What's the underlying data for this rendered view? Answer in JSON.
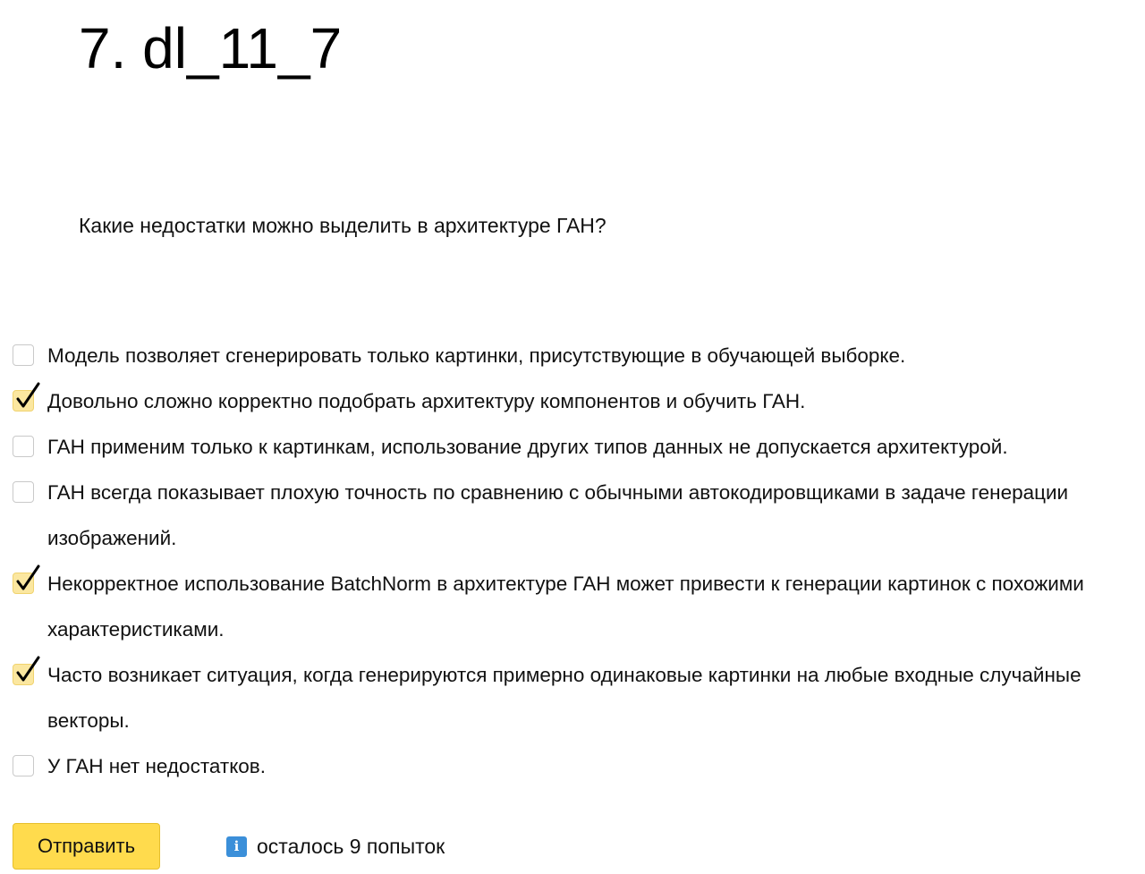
{
  "task": {
    "title": "7. dl_11_7",
    "question": "Какие недостатки можно выделить в архитектуре ГАН?"
  },
  "options": [
    {
      "label": "Модель позволяет сгенерировать только картинки, присутствующие в обучающей выборке.",
      "checked": false
    },
    {
      "label": "Довольно сложно корректно подобрать архитектуру компонентов и обучить ГАН.",
      "checked": true
    },
    {
      "label": "ГАН применим только к картинкам, использование других типов данных не допускается архитектурой.",
      "checked": false
    },
    {
      "label": "ГАН всегда показывает плохую точность по сравнению с обычными автокодировщиками в задаче генерации изображений.",
      "checked": false
    },
    {
      "label": "Некорректное использование BatchNorm в архитектуре ГАН может привести к генерации картинок с похожими характеристиками.",
      "checked": true
    },
    {
      "label": "Часто возникает ситуация, когда генерируются примерно одинаковые картинки на любые входные случайные векторы.",
      "checked": true
    },
    {
      "label": "У ГАН нет недостатков.",
      "checked": false
    }
  ],
  "footer": {
    "submit_label": "Отправить",
    "info_icon_glyph": "i",
    "attempts_text": "осталось 9 попыток"
  },
  "colors": {
    "submit_button": "#ffdb4d",
    "checked_box": "#fbe7a0",
    "info_icon": "#3b8fd9"
  },
  "icons": {
    "checkmark": "checkmark-icon",
    "info": "info-icon"
  }
}
